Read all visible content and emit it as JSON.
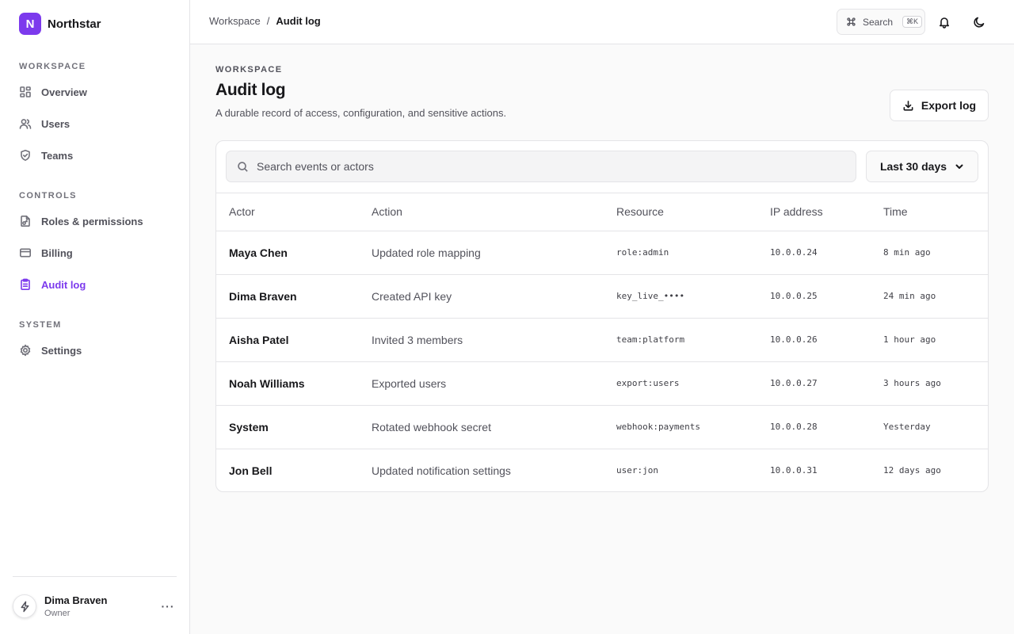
{
  "brand": {
    "logo_letter": "N",
    "name": "Northstar",
    "accent": "#7c3aed"
  },
  "sidebar": {
    "sections": [
      {
        "label": "Workspace",
        "items": [
          {
            "label": "Overview",
            "icon": "grid-icon"
          },
          {
            "label": "Users",
            "icon": "users-icon"
          },
          {
            "label": "Teams",
            "icon": "shield-icon"
          }
        ]
      },
      {
        "label": "Controls",
        "items": [
          {
            "label": "Roles & permissions",
            "icon": "file-key-icon"
          },
          {
            "label": "Billing",
            "icon": "credit-card-icon"
          },
          {
            "label": "Audit log",
            "icon": "clipboard-icon",
            "active": true
          }
        ]
      },
      {
        "label": "System",
        "items": [
          {
            "label": "Settings",
            "icon": "gear-icon"
          }
        ]
      }
    ],
    "user": {
      "name": "Dima Braven",
      "role": "Owner"
    }
  },
  "topbar": {
    "breadcrumb": [
      "Workspace",
      "Audit log"
    ],
    "breadcrumb_separator": "/",
    "search_label": "Search",
    "search_shortcut": "⌘K"
  },
  "page": {
    "eyebrow": "WORKSPACE",
    "title": "Audit log",
    "subtitle": "A durable record of access, configuration, and sensitive actions.",
    "export_label": "Export log"
  },
  "filters": {
    "search_placeholder": "Search events or actors",
    "search_value": "",
    "range_selected": "Last 30 days"
  },
  "table": {
    "columns": [
      "Actor",
      "Action",
      "Resource",
      "IP address",
      "Time"
    ],
    "rows": [
      {
        "actor": "Maya Chen",
        "action": "Updated role mapping",
        "resource": "role:admin",
        "ip": "10.0.0.24",
        "time": "8 min ago"
      },
      {
        "actor": "Dima Braven",
        "action": "Created API key",
        "resource": "key_live_••••",
        "ip": "10.0.0.25",
        "time": "24 min ago"
      },
      {
        "actor": "Aisha Patel",
        "action": "Invited 3 members",
        "resource": "team:platform",
        "ip": "10.0.0.26",
        "time": "1 hour ago"
      },
      {
        "actor": "Noah Williams",
        "action": "Exported users",
        "resource": "export:users",
        "ip": "10.0.0.27",
        "time": "3 hours ago"
      },
      {
        "actor": "System",
        "action": "Rotated webhook secret",
        "resource": "webhook:payments",
        "ip": "10.0.0.28",
        "time": "Yesterday"
      },
      {
        "actor": "Jon Bell",
        "action": "Updated notification settings",
        "resource": "user:jon",
        "ip": "10.0.0.31",
        "time": "12 days ago"
      }
    ]
  }
}
